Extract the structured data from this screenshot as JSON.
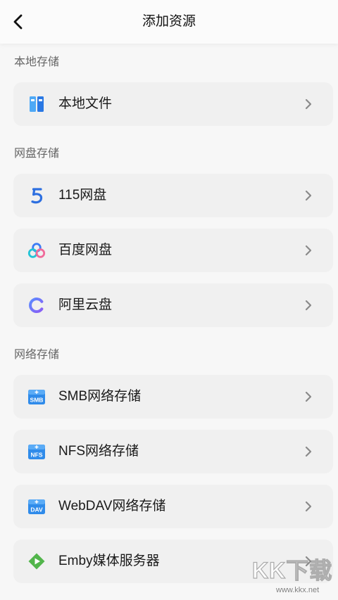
{
  "header": {
    "title": "添加资源",
    "back_icon": "chevron-left-icon"
  },
  "sections": [
    {
      "label": "本地存储",
      "items": [
        {
          "label": "本地文件",
          "icon": "local-folder-icon"
        }
      ]
    },
    {
      "label": "网盘存储",
      "items": [
        {
          "label": "115网盘",
          "icon": "115-logo-icon"
        },
        {
          "label": "百度网盘",
          "icon": "baidu-netdisk-icon"
        },
        {
          "label": "阿里云盘",
          "icon": "aliyun-drive-icon"
        }
      ]
    },
    {
      "label": "网络存储",
      "items": [
        {
          "label": "SMB网络存储",
          "icon": "smb-icon",
          "badge": "SMB"
        },
        {
          "label": "NFS网络存储",
          "icon": "nfs-icon",
          "badge": "NFS"
        },
        {
          "label": "WebDAV网络存储",
          "icon": "webdav-icon",
          "badge": "DAV"
        },
        {
          "label": "Emby媒体服务器",
          "icon": "emby-icon"
        }
      ]
    }
  ],
  "row_action_icon": "chevron-right-icon",
  "watermark": {
    "brand": "KK下载",
    "url": "www.kkx.net"
  },
  "colors": {
    "background": "#f7f7f7",
    "header": "#fbfbfb",
    "card": "#f0f0f0",
    "text": "#1a1a1a",
    "section_label": "#666666",
    "chevron": "#8a8a8a"
  }
}
